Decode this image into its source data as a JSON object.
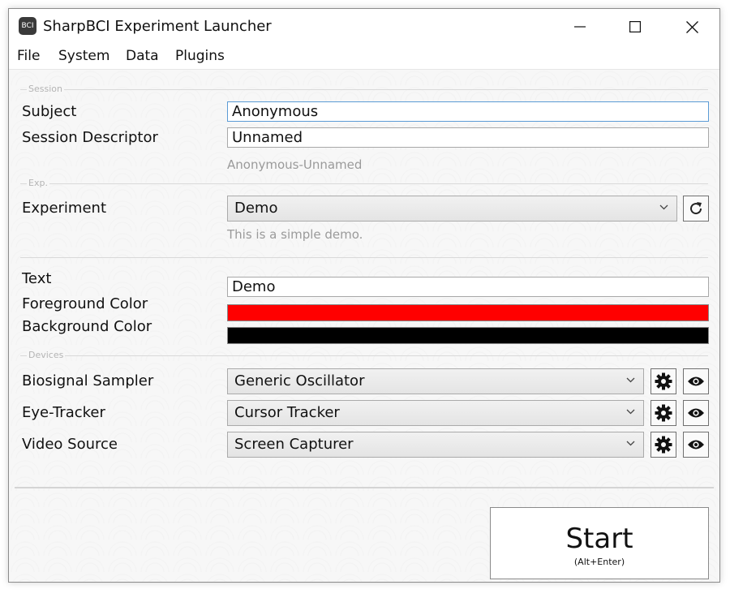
{
  "window": {
    "title": "SharpBCI Experiment Launcher",
    "icon_text": "BCI",
    "controls": {
      "minimize": "minimize-icon",
      "maximize": "maximize-icon",
      "close": "close-icon"
    }
  },
  "menu": {
    "items": [
      "File",
      "System",
      "Data",
      "Plugins"
    ]
  },
  "session": {
    "header": "Session",
    "subject_label": "Subject",
    "subject_value": "Anonymous",
    "descriptor_label": "Session Descriptor",
    "descriptor_value": "Unnamed",
    "preview": "Anonymous-Unnamed"
  },
  "experiment": {
    "header": "Exp.",
    "label": "Experiment",
    "selected": "Demo",
    "description": "This is a simple demo.",
    "refresh_icon": "refresh-icon"
  },
  "params": {
    "text_label": "Text",
    "text_value": "Demo",
    "fg_label": "Foreground Color",
    "fg_color": "#ff0000",
    "bg_label": "Background Color",
    "bg_color": "#000000"
  },
  "devices": {
    "header": "Devices",
    "rows": [
      {
        "label": "Biosignal Sampler",
        "selected": "Generic Oscillator"
      },
      {
        "label": "Eye-Tracker",
        "selected": "Cursor Tracker"
      },
      {
        "label": "Video Source",
        "selected": "Screen Capturer"
      }
    ],
    "settings_icon": "gear-icon",
    "preview_icon": "eye-icon"
  },
  "start": {
    "label": "Start",
    "shortcut": "(Alt+Enter)"
  },
  "colors": {
    "focus_border": "#5b9bd5",
    "window_border": "#8c8c8c"
  }
}
